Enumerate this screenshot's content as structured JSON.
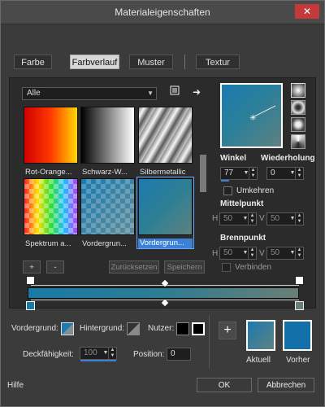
{
  "window": {
    "title": "Materialeigenschaften",
    "close_glyph": "✕"
  },
  "tabs": [
    "Farbe",
    "Farbverlauf",
    "Muster",
    "Textur"
  ],
  "library": {
    "category": "Alle",
    "swatches": [
      {
        "label": "Rot-Orange..."
      },
      {
        "label": "Schwarz-W..."
      },
      {
        "label": "Silbermetallic"
      },
      {
        "label": "Spektrum a..."
      },
      {
        "label": "Vordergrun..."
      },
      {
        "label": "Vordergrun..."
      }
    ],
    "add_label": "+",
    "remove_label": "-",
    "reset_label": "Zurücksetzen",
    "save_label": "Speichern"
  },
  "gradient_settings": {
    "angle_label": "Winkel",
    "angle_value": "77",
    "repeat_label": "Wiederholung",
    "repeat_value": "0",
    "invert_label": "Umkehren",
    "midpoint_label": "Mittelpunkt",
    "focal_label": "Brennpunkt",
    "h_label": "H",
    "v_label": "V",
    "mid_h": "50",
    "mid_v": "50",
    "focal_h": "50",
    "focal_v": "50",
    "link_label": "Verbinden"
  },
  "colors": {
    "foreground_label": "Vordergrund:",
    "background_label": "Hintergrund:",
    "user_label": "Nutzer:",
    "opacity_label": "Deckfähigkeit:",
    "opacity_value": "100",
    "position_label": "Position:",
    "position_value": "0",
    "add_label": "+",
    "current_label": "Aktuell",
    "previous_label": "Vorher"
  },
  "footer": {
    "help_label": "Hilfe",
    "ok_label": "OK",
    "cancel_label": "Abbrechen"
  }
}
